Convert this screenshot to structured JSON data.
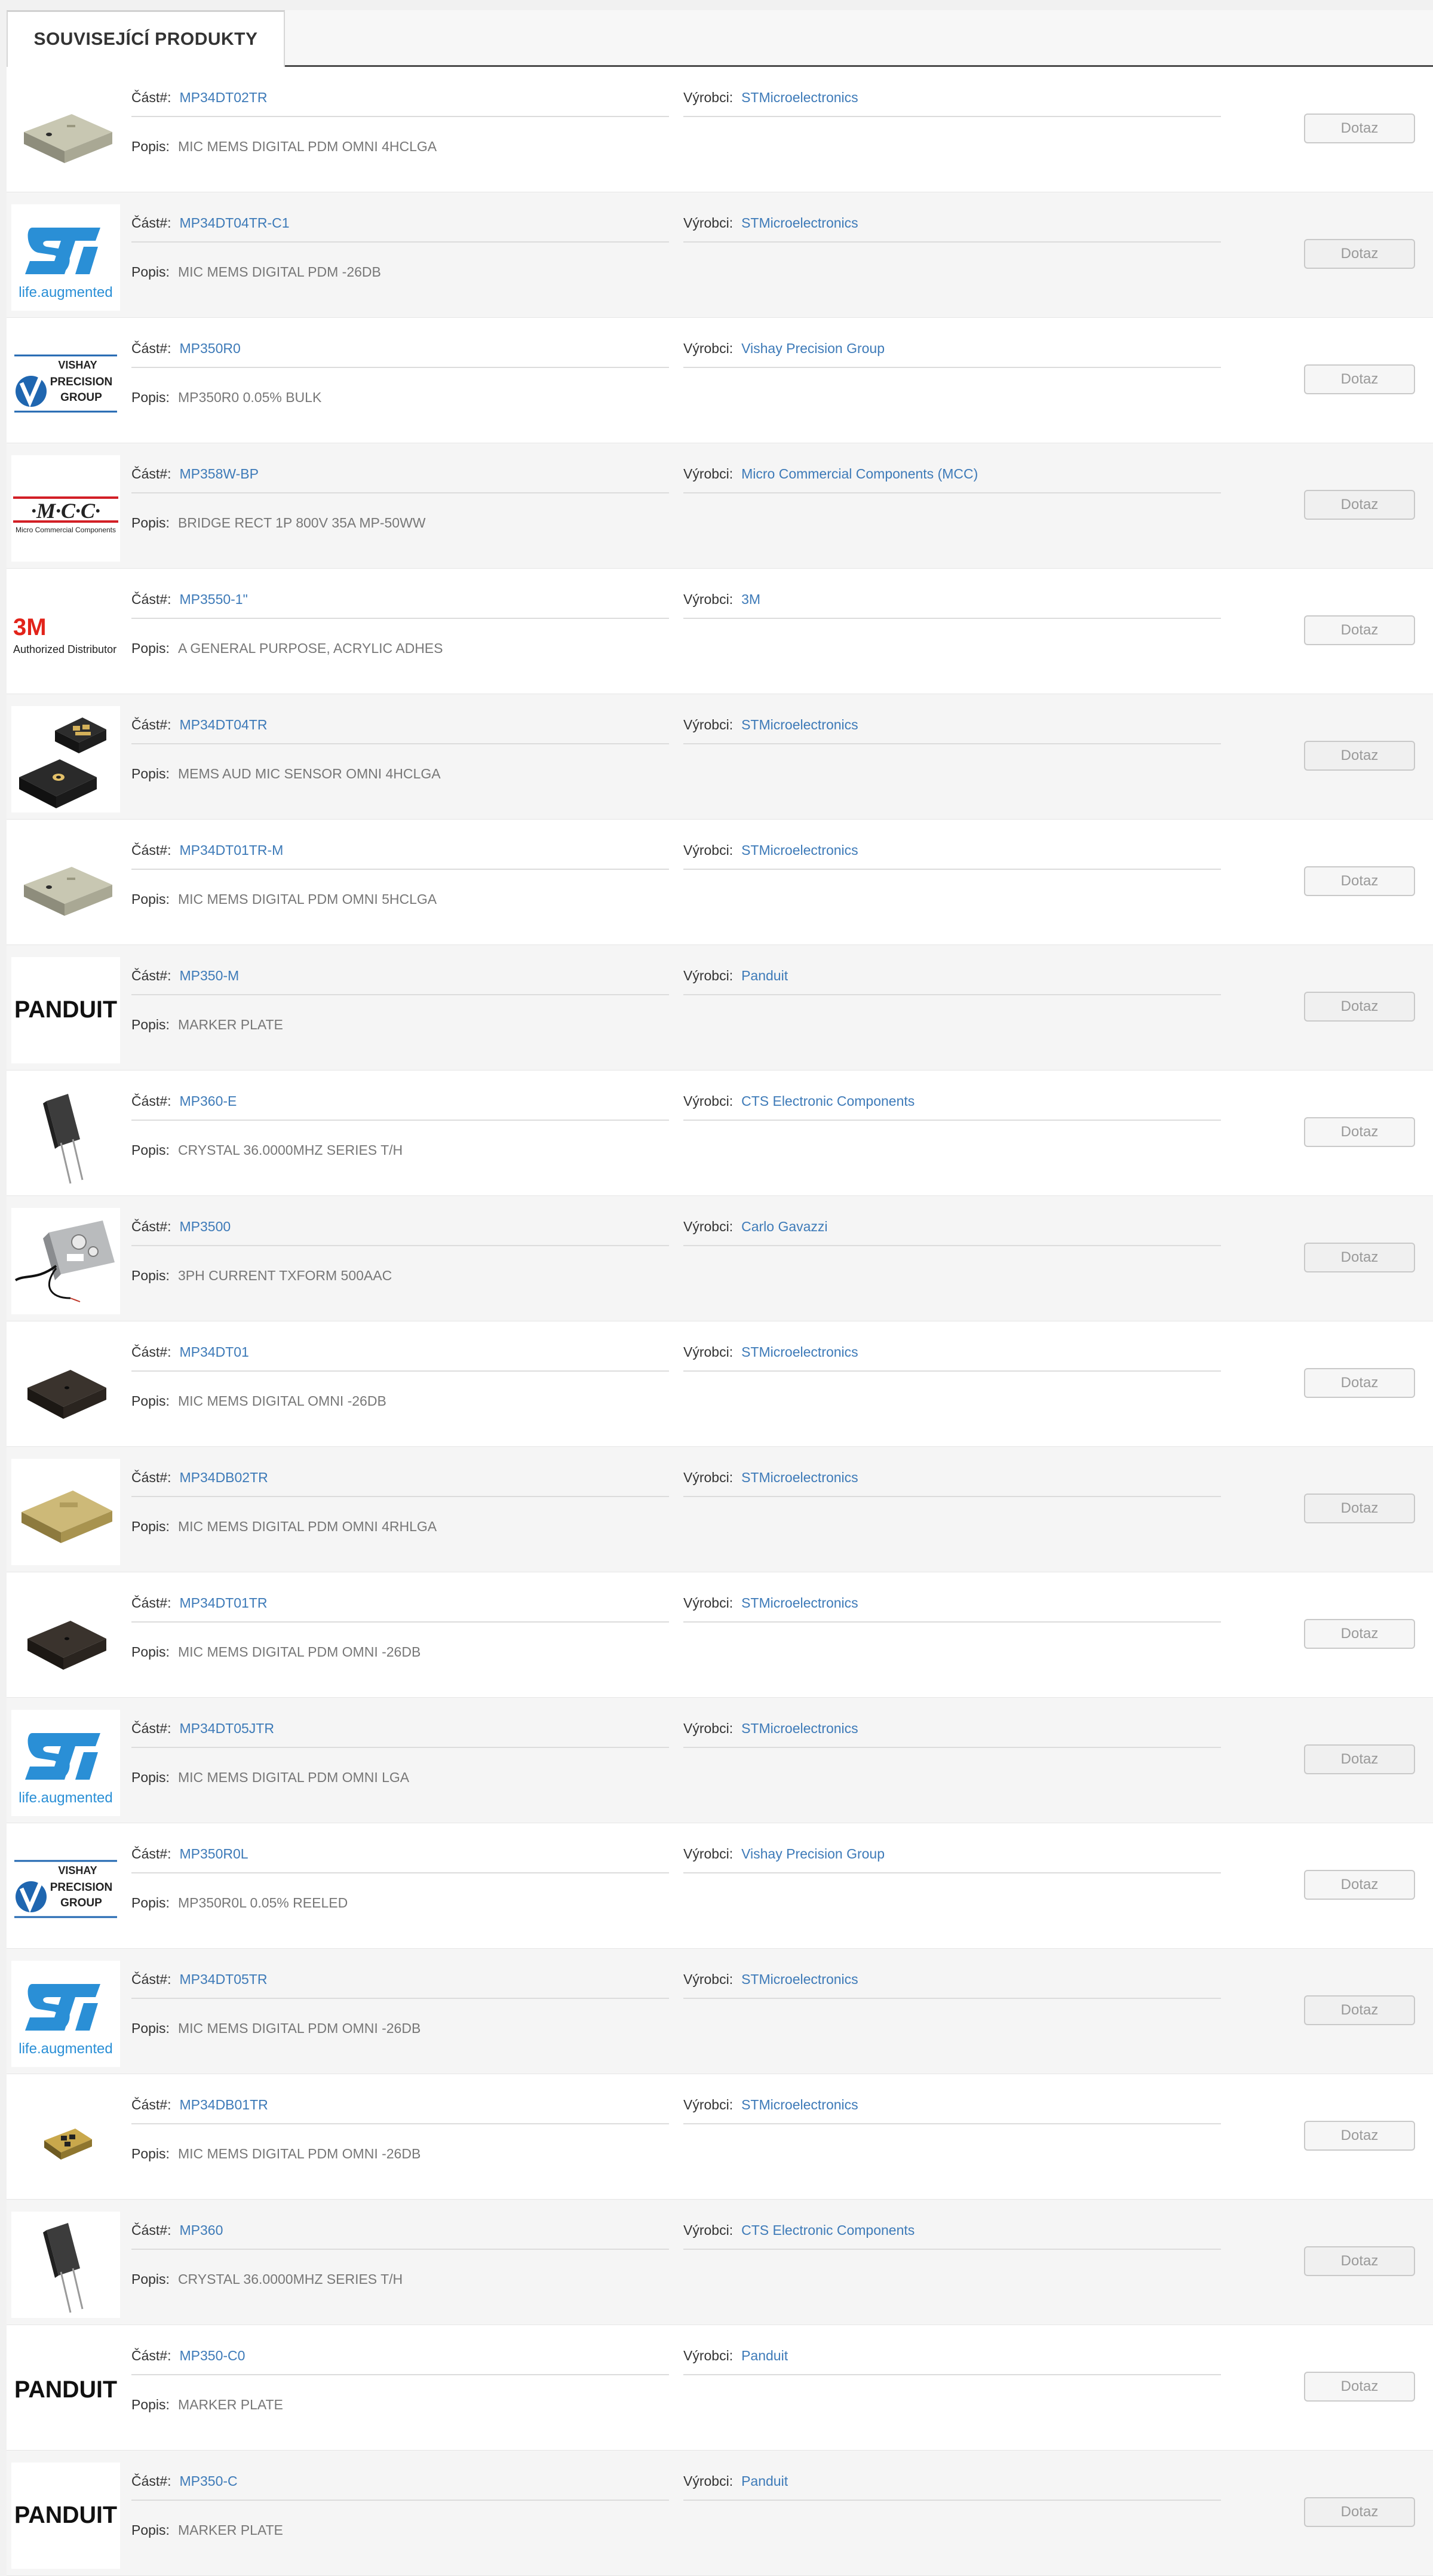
{
  "tab": {
    "label": "SOUVISEJÍCÍ PRODUKTY"
  },
  "labels": {
    "part": "Část#:",
    "manufacturer": "Výrobci:",
    "description": "Popis:",
    "button": "Dotaz"
  },
  "logos": {
    "st_tagline": "life.augmented",
    "vishay_top": "VISHAY",
    "vishay_mid": "PRECISION",
    "vishay_bot": "GROUP",
    "mcc_big": "·M·C·C·",
    "mcc_small": "Micro Commercial Components",
    "m3_big": "3M",
    "m3_small": "Authorized Distributor",
    "panduit": "PANDUIT"
  },
  "products": [
    {
      "part": "MP34DT02TR",
      "manufacturer": "STMicroelectronics",
      "description": "MIC MEMS DIGITAL PDM OMNI 4HCLGA",
      "image": "mems-mic-large-icon"
    },
    {
      "part": "MP34DT04TR-C1",
      "manufacturer": "STMicroelectronics",
      "description": "MIC MEMS DIGITAL PDM -26DB",
      "image": "st-logo"
    },
    {
      "part": "MP350R0",
      "manufacturer": "Vishay Precision Group",
      "description": "MP350R0 0.05% BULK",
      "image": "vishay-logo"
    },
    {
      "part": "MP358W-BP",
      "manufacturer": "Micro Commercial Components (MCC)",
      "description": "BRIDGE RECT 1P 800V 35A MP-50WW",
      "image": "mcc-logo"
    },
    {
      "part": "MP3550-1\"",
      "manufacturer": "3M",
      "description": "A GENERAL PURPOSE, ACRYLIC ADHES",
      "image": "3m-logo"
    },
    {
      "part": "MP34DT04TR",
      "manufacturer": "STMicroelectronics",
      "description": "MEMS AUD MIC SENSOR OMNI 4HCLGA",
      "image": "mems-sensor-pair-icon"
    },
    {
      "part": "MP34DT01TR-M",
      "manufacturer": "STMicroelectronics",
      "description": "MIC MEMS DIGITAL PDM OMNI 5HCLGA",
      "image": "mems-mic-large-icon"
    },
    {
      "part": "MP350-M",
      "manufacturer": "Panduit",
      "description": "MARKER PLATE",
      "image": "panduit-logo"
    },
    {
      "part": "MP360-E",
      "manufacturer": "CTS Electronic Components",
      "description": "CRYSTAL 36.0000MHZ SERIES T/H",
      "image": "crystal-icon"
    },
    {
      "part": "MP3500",
      "manufacturer": "Carlo Gavazzi",
      "description": "3PH CURRENT TXFORM 500AAC",
      "image": "transformer-icon"
    },
    {
      "part": "MP34DT01",
      "manufacturer": "STMicroelectronics",
      "description": "MIC MEMS DIGITAL OMNI -26DB",
      "image": "black-chip-icon"
    },
    {
      "part": "MP34DB02TR",
      "manufacturer": "STMicroelectronics",
      "description": "MIC MEMS DIGITAL PDM OMNI 4RHLGA",
      "image": "gold-mic-icon"
    },
    {
      "part": "MP34DT01TR",
      "manufacturer": "STMicroelectronics",
      "description": "MIC MEMS DIGITAL PDM OMNI -26DB",
      "image": "black-chip-icon"
    },
    {
      "part": "MP34DT05JTR",
      "manufacturer": "STMicroelectronics",
      "description": "MIC MEMS DIGITAL PDM OMNI LGA",
      "image": "st-logo"
    },
    {
      "part": "MP350R0L",
      "manufacturer": "Vishay Precision Group",
      "description": "MP350R0L 0.05% REELED",
      "image": "vishay-logo"
    },
    {
      "part": "MP34DT05TR",
      "manufacturer": "STMicroelectronics",
      "description": "MIC MEMS DIGITAL PDM OMNI -26DB",
      "image": "st-logo"
    },
    {
      "part": "MP34DB01TR",
      "manufacturer": "STMicroelectronics",
      "description": "MIC MEMS DIGITAL PDM OMNI -26DB",
      "image": "small-gold-mic-icon"
    },
    {
      "part": "MP360",
      "manufacturer": "CTS Electronic Components",
      "description": "CRYSTAL 36.0000MHZ SERIES T/H",
      "image": "crystal-icon"
    },
    {
      "part": "MP350-C0",
      "manufacturer": "Panduit",
      "description": "MARKER PLATE",
      "image": "panduit-logo"
    },
    {
      "part": "MP350-C",
      "manufacturer": "Panduit",
      "description": "MARKER PLATE",
      "image": "panduit-logo"
    }
  ],
  "colors": {
    "link": "#3d7ab8",
    "st_blue": "#2a8fd6",
    "mcc_red": "#d21f26",
    "m3_red": "#e2231a",
    "vishay_blue": "#1f66b0"
  }
}
